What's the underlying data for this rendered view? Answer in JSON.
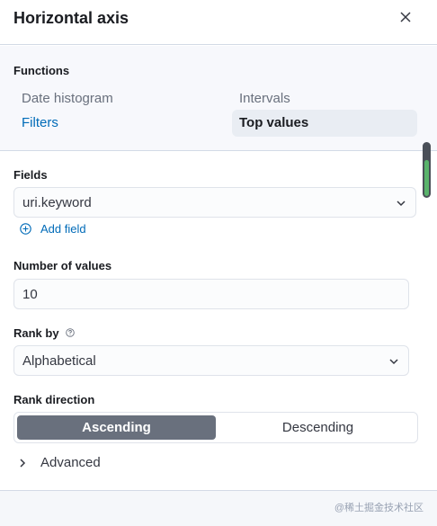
{
  "header": {
    "title": "Horizontal axis"
  },
  "functions": {
    "label": "Functions",
    "items": [
      {
        "label": "Date histogram"
      },
      {
        "label": "Intervals"
      },
      {
        "label": "Filters"
      },
      {
        "label": "Top values"
      }
    ],
    "selected": "Top values"
  },
  "fields": {
    "label": "Fields",
    "value": "uri.keyword",
    "add_label": "Add field"
  },
  "number_of_values": {
    "label": "Number of values",
    "value": "10"
  },
  "rank_by": {
    "label": "Rank by",
    "value": "Alphabetical"
  },
  "rank_direction": {
    "label": "Rank direction",
    "options": [
      "Ascending",
      "Descending"
    ],
    "selected": "Ascending"
  },
  "advanced": {
    "label": "Advanced"
  },
  "footer": {
    "watermark": "@稀土掘金技术社区"
  },
  "colors": {
    "link": "#006bb8",
    "selected_button": "#69707d",
    "border": "#d3dae6"
  }
}
